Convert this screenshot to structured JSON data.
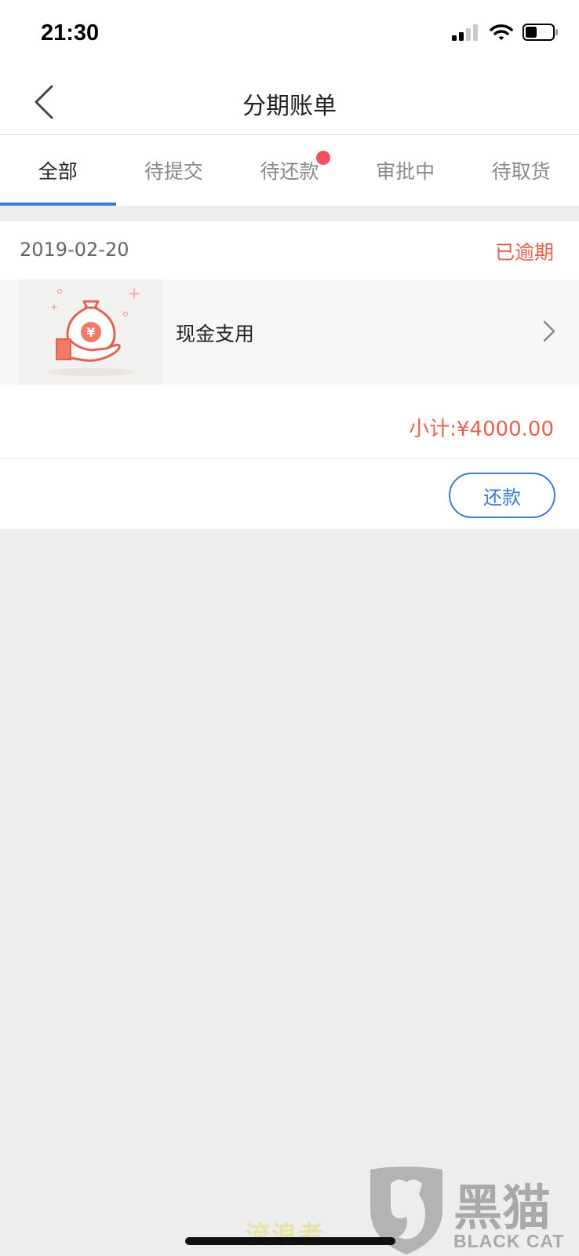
{
  "status_bar": {
    "time": "21:30"
  },
  "nav": {
    "title": "分期账单"
  },
  "tabs": [
    {
      "label": "全部",
      "active": true
    },
    {
      "label": "待提交",
      "active": false
    },
    {
      "label": "待还款",
      "active": false,
      "has_dot": true
    },
    {
      "label": "审批中",
      "active": false
    },
    {
      "label": "待取货",
      "active": false
    }
  ],
  "bill": {
    "date": "2019-02-20",
    "status": "已逾期",
    "item_name": "现金支用",
    "subtotal": "小计:¥4000.00",
    "action_label": "还款",
    "item_icon": "money-bag-hand-icon"
  },
  "colors": {
    "accent_blue": "#3a7bd5",
    "overdue_red": "#e5614f",
    "badge_red": "#f05262",
    "background": "#ededed"
  },
  "watermark": {
    "text": "流浪者",
    "logo_cn": "黑猫",
    "logo_en": "BLACK CAT"
  }
}
